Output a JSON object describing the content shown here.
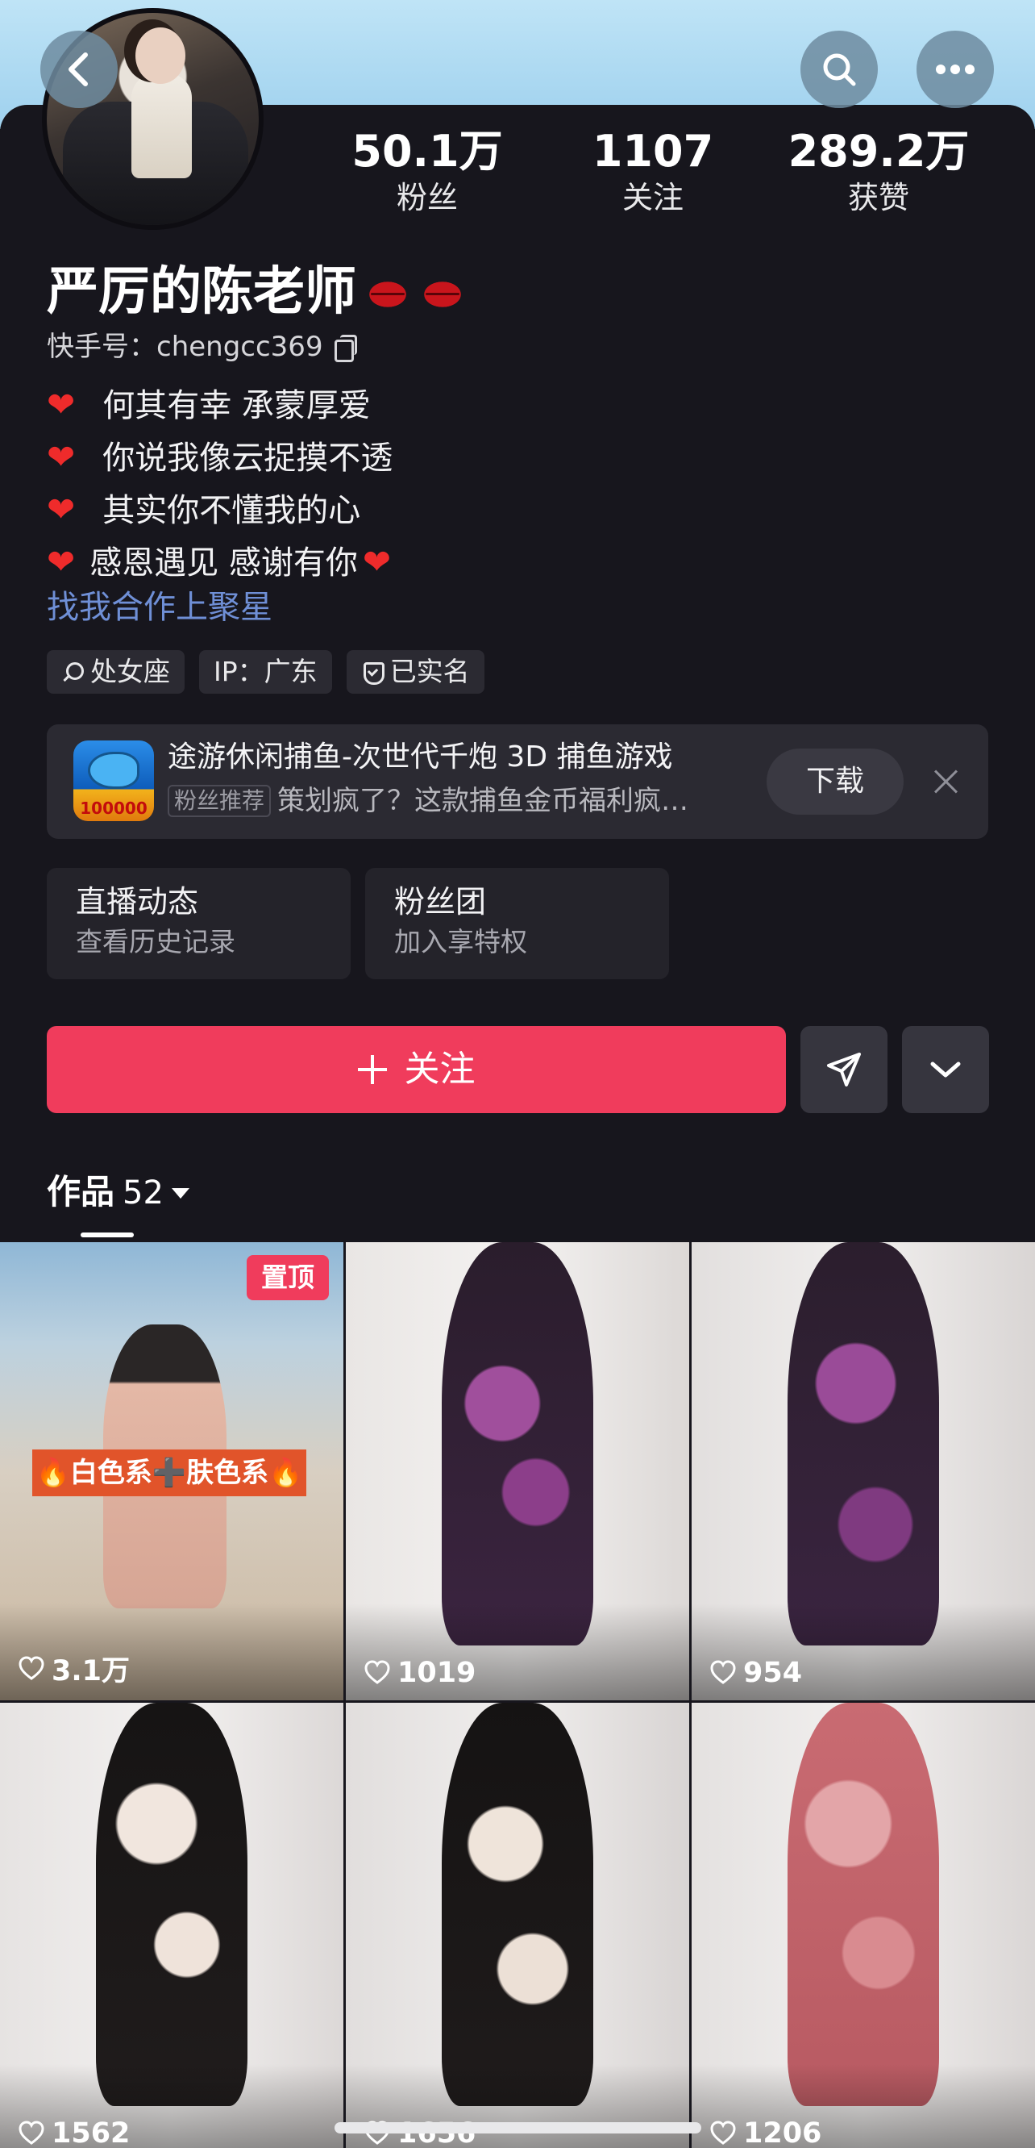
{
  "profile": {
    "display_name": "严厉的陈老师",
    "ks_id": "快手号：chengcc369",
    "stats": {
      "fans_value": "50.1万",
      "fans_label": "粉丝",
      "following_value": "1107",
      "following_label": "关注",
      "likes_value": "289.2万",
      "likes_label": "获赞"
    },
    "bio": [
      "何其有幸 承蒙厚爱",
      "你说我像云捉摸不透",
      "其实你不懂我的心",
      "感恩遇见 感谢有你"
    ],
    "coop_link": "找我合作上聚星",
    "tags": [
      "处女座",
      "IP：广东",
      "已实名"
    ]
  },
  "ad": {
    "title": "途游休闲捕鱼-次世代千炮 3D 捕鱼游戏",
    "badge": "粉丝推荐",
    "subtitle": "策划疯了？这款捕鱼金币福利疯…",
    "download": "下载",
    "icon_text": "100000"
  },
  "cards": {
    "live": {
      "title": "直播动态",
      "subtitle": "查看历史记录"
    },
    "fans": {
      "title": "粉丝团",
      "subtitle": "加入享特权"
    }
  },
  "actions": {
    "follow_label": "关注"
  },
  "works": {
    "tab_label": "作品",
    "count": "52",
    "items": [
      {
        "likes": "3.1万",
        "pinned_label": "置顶",
        "caption": "🔥白色系➕肤色系🔥"
      },
      {
        "likes": "1019"
      },
      {
        "likes": "954"
      },
      {
        "likes": "1562"
      },
      {
        "likes": "1656"
      },
      {
        "likes": "1206"
      }
    ]
  },
  "icons": {
    "back": "chevron-left-icon",
    "search": "search-icon",
    "more": "more-icon",
    "share": "send-icon",
    "expand": "chevron-down-icon"
  },
  "colors": {
    "accent": "#f03c5c",
    "background": "#17161d",
    "link": "#6f8fd6"
  }
}
